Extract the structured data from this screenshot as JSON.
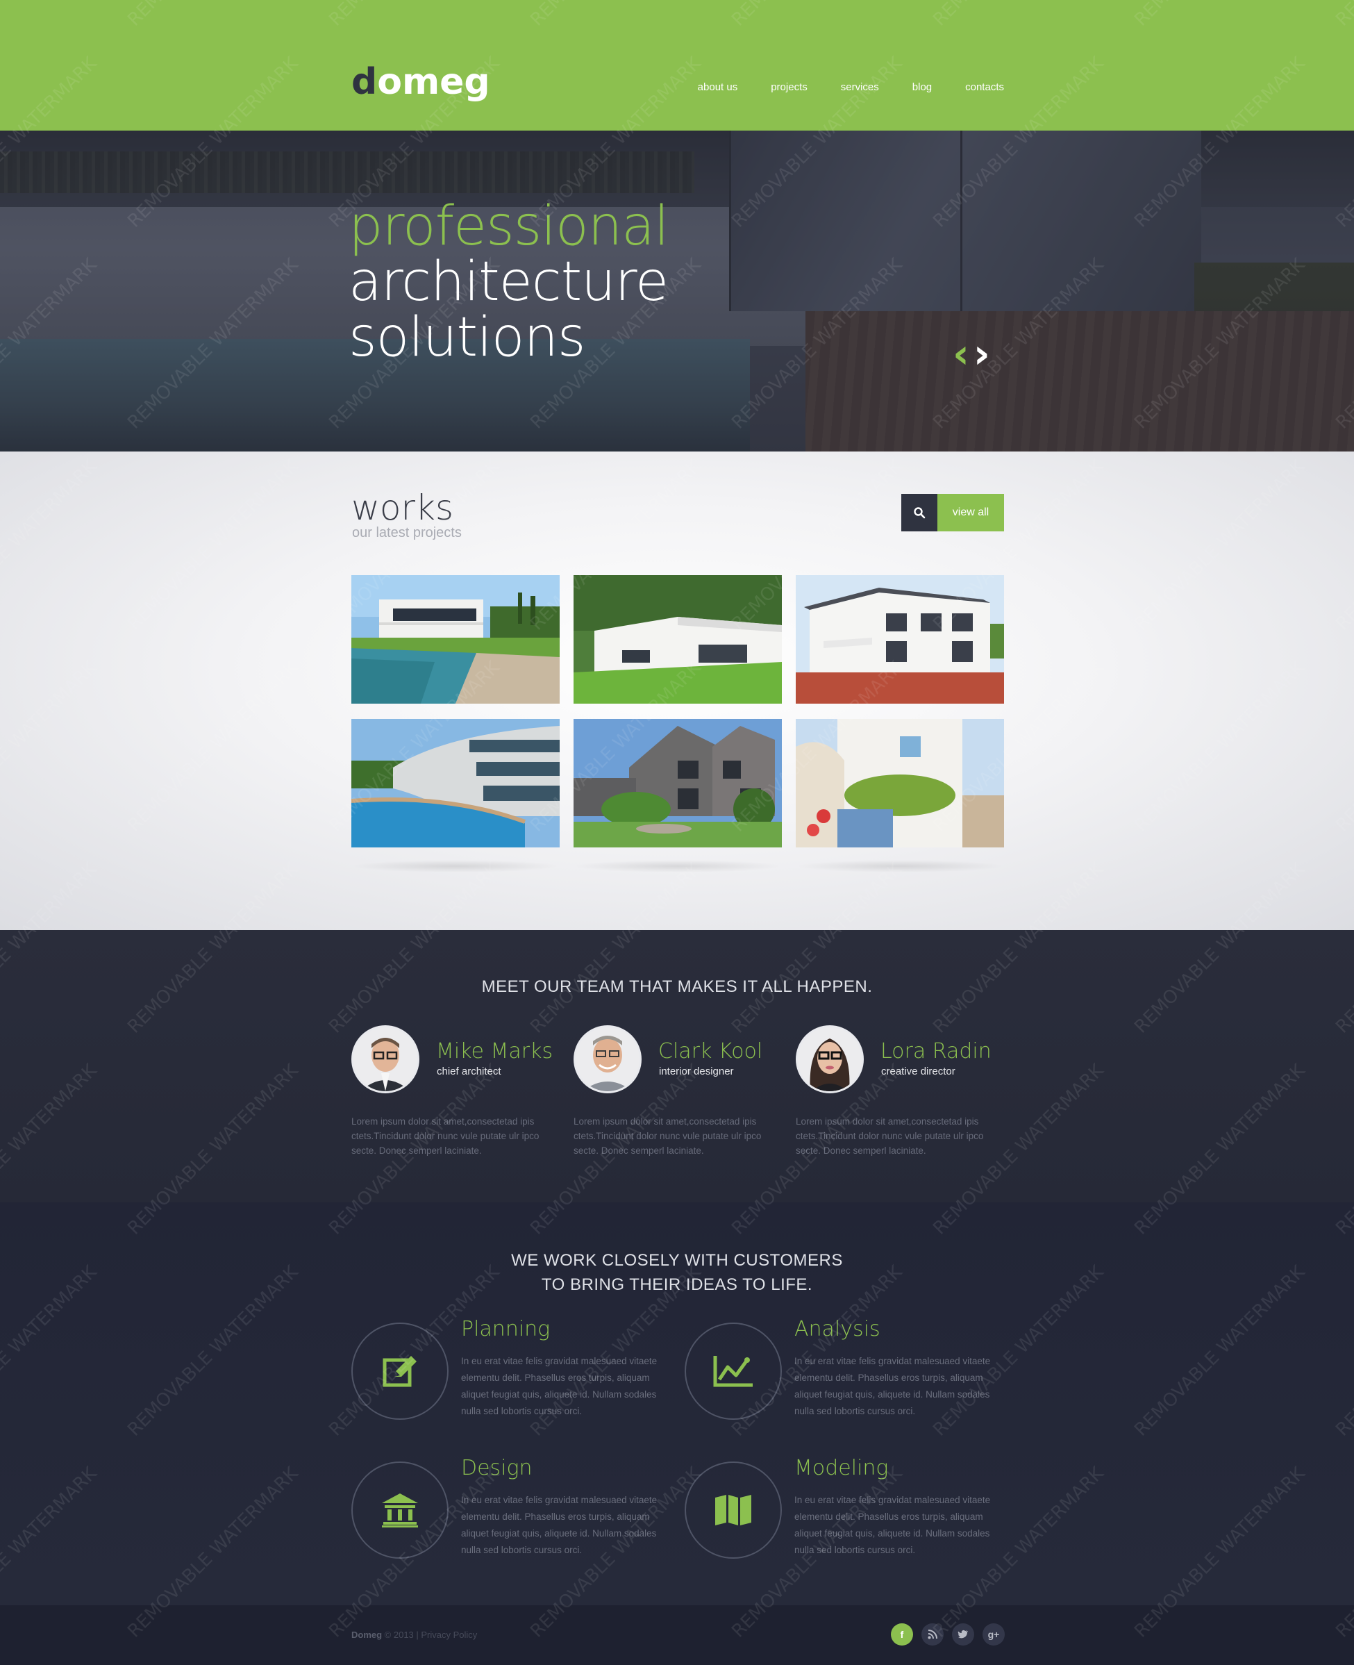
{
  "header": {
    "logo_d": "d",
    "logo_rest": "omeg",
    "nav": [
      "about us",
      "projects",
      "services",
      "blog",
      "contacts"
    ]
  },
  "hero": {
    "line1": "professional",
    "line2": "architecture",
    "line3": "solutions",
    "prev_icon": "chevron-left-icon",
    "next_icon": "chevron-right-icon"
  },
  "works": {
    "title": "works",
    "subtitle": "our latest projects",
    "search_icon": "search-icon",
    "view_all": "view all",
    "thumbnails": [
      "modern villa with pool",
      "white modern house on lawn",
      "white colonial house with patio",
      "curved building with pool",
      "grey brick house with garden",
      "mediterranean white house"
    ]
  },
  "team": {
    "heading": "MEET OUR TEAM THAT MAKES IT ALL HAPPEN.",
    "members": [
      {
        "name": "Mike Marks",
        "role": "chief architect",
        "bio": "Lorem ipsum dolor sit amet,consectetad ipis ctets.Tincidunt dolor nunc vule putate ulr ipco secte. Donec semperl laciniate."
      },
      {
        "name": "Clark Kool",
        "role": "interior designer",
        "bio": "Lorem ipsum dolor sit amet,consectetad ipis ctets.Tincidunt dolor nunc vule putate ulr ipco secte. Donec semperl laciniate."
      },
      {
        "name": "Lora Radin",
        "role": "creative director",
        "bio": "Lorem ipsum dolor sit amet,consectetad ipis ctets.Tincidunt dolor nunc vule putate ulr ipco secte. Donec semperl laciniate."
      }
    ]
  },
  "services": {
    "heading_line1": "WE WORK CLOSELY WITH CUSTOMERS",
    "heading_line2": "TO BRING THEIR IDEAS TO LIFE.",
    "items": [
      {
        "title": "Planning",
        "icon": "edit-icon",
        "text": "In eu erat vitae felis gravidat malesuaed vitaete elementu delit. Phasellus eros turpis, aliquam aliquet feugiat quis, aliquete id. Nullam sodales nulla sed lobortis cursus orci."
      },
      {
        "title": "Analysis",
        "icon": "line-chart-icon",
        "text": "In eu erat vitae felis gravidat malesuaed vitaete elementu delit. Phasellus eros turpis, aliquam aliquet feugiat quis, aliquete id. Nullam sodales nulla sed lobortis cursus orci."
      },
      {
        "title": "Design",
        "icon": "bank-icon",
        "text": "In eu erat vitae felis gravidat malesuaed vitaete elementu delit. Phasellus eros turpis, aliquam aliquet feugiat quis, aliquete id. Nullam sodales nulla sed lobortis cursus orci."
      },
      {
        "title": "Modeling",
        "icon": "map-icon",
        "text": "In eu erat vitae felis gravidat malesuaed vitaete elementu delit. Phasellus eros turpis, aliquam aliquet feugiat quis, aliquete id. Nullam sodales nulla sed lobortis cursus orci."
      }
    ]
  },
  "footer": {
    "brand": "Domeg",
    "copyright": " © 2013 | ",
    "privacy": "Privacy Policy",
    "social": [
      {
        "icon": "facebook-icon",
        "glyph": "f"
      },
      {
        "icon": "rss-icon",
        "glyph": "∷"
      },
      {
        "icon": "twitter-icon",
        "glyph": "t"
      },
      {
        "icon": "google-plus-icon",
        "glyph": "g+"
      }
    ]
  },
  "watermark": "REMOVABLE WATERMARK",
  "colors": {
    "accent": "#8cc04f",
    "dark": "#2f3340",
    "team_bg": "#2a2d3b",
    "services_bg": "#23263a"
  }
}
